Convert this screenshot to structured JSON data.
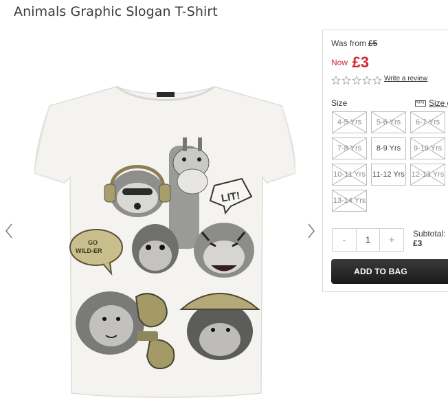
{
  "product": {
    "title": "Animals Graphic Slogan T-Shirt"
  },
  "gallery": {
    "image_alt": "Animals graphic slogan t-shirt",
    "prev_icon": "chevron-left-icon",
    "next_icon": "chevron-right-icon",
    "print_bubbles": [
      "LIT!",
      "GO WILD-ER"
    ]
  },
  "price": {
    "was_label": "Was from",
    "was_amount": "£5",
    "now_label": "Now",
    "now_amount": "£3",
    "accent_color": "#d0262d"
  },
  "rating": {
    "stars_filled": 0,
    "stars_total": 5,
    "review_link": "Write a review"
  },
  "size": {
    "label": "Size",
    "guide_label": "Size g",
    "options": [
      {
        "label": "4-5 Yrs",
        "available": false
      },
      {
        "label": "5-6 Yrs",
        "available": false
      },
      {
        "label": "6-7 Yrs",
        "available": false
      },
      {
        "label": "7-8 Yrs",
        "available": false
      },
      {
        "label": "8-9 Yrs",
        "available": true
      },
      {
        "label": "9-10 Yrs",
        "available": false
      },
      {
        "label": "10-11 Yrs",
        "available": false
      },
      {
        "label": "11-12 Yrs",
        "available": true
      },
      {
        "label": "12-13 Yrs",
        "available": false
      },
      {
        "label": "13-14 Yrs",
        "available": false
      }
    ]
  },
  "quantity": {
    "minus": "-",
    "value": "1",
    "plus": "+"
  },
  "subtotal": {
    "label": "Subtotal:",
    "amount": "£3"
  },
  "cta": {
    "add_to_bag": "ADD TO BAG"
  }
}
